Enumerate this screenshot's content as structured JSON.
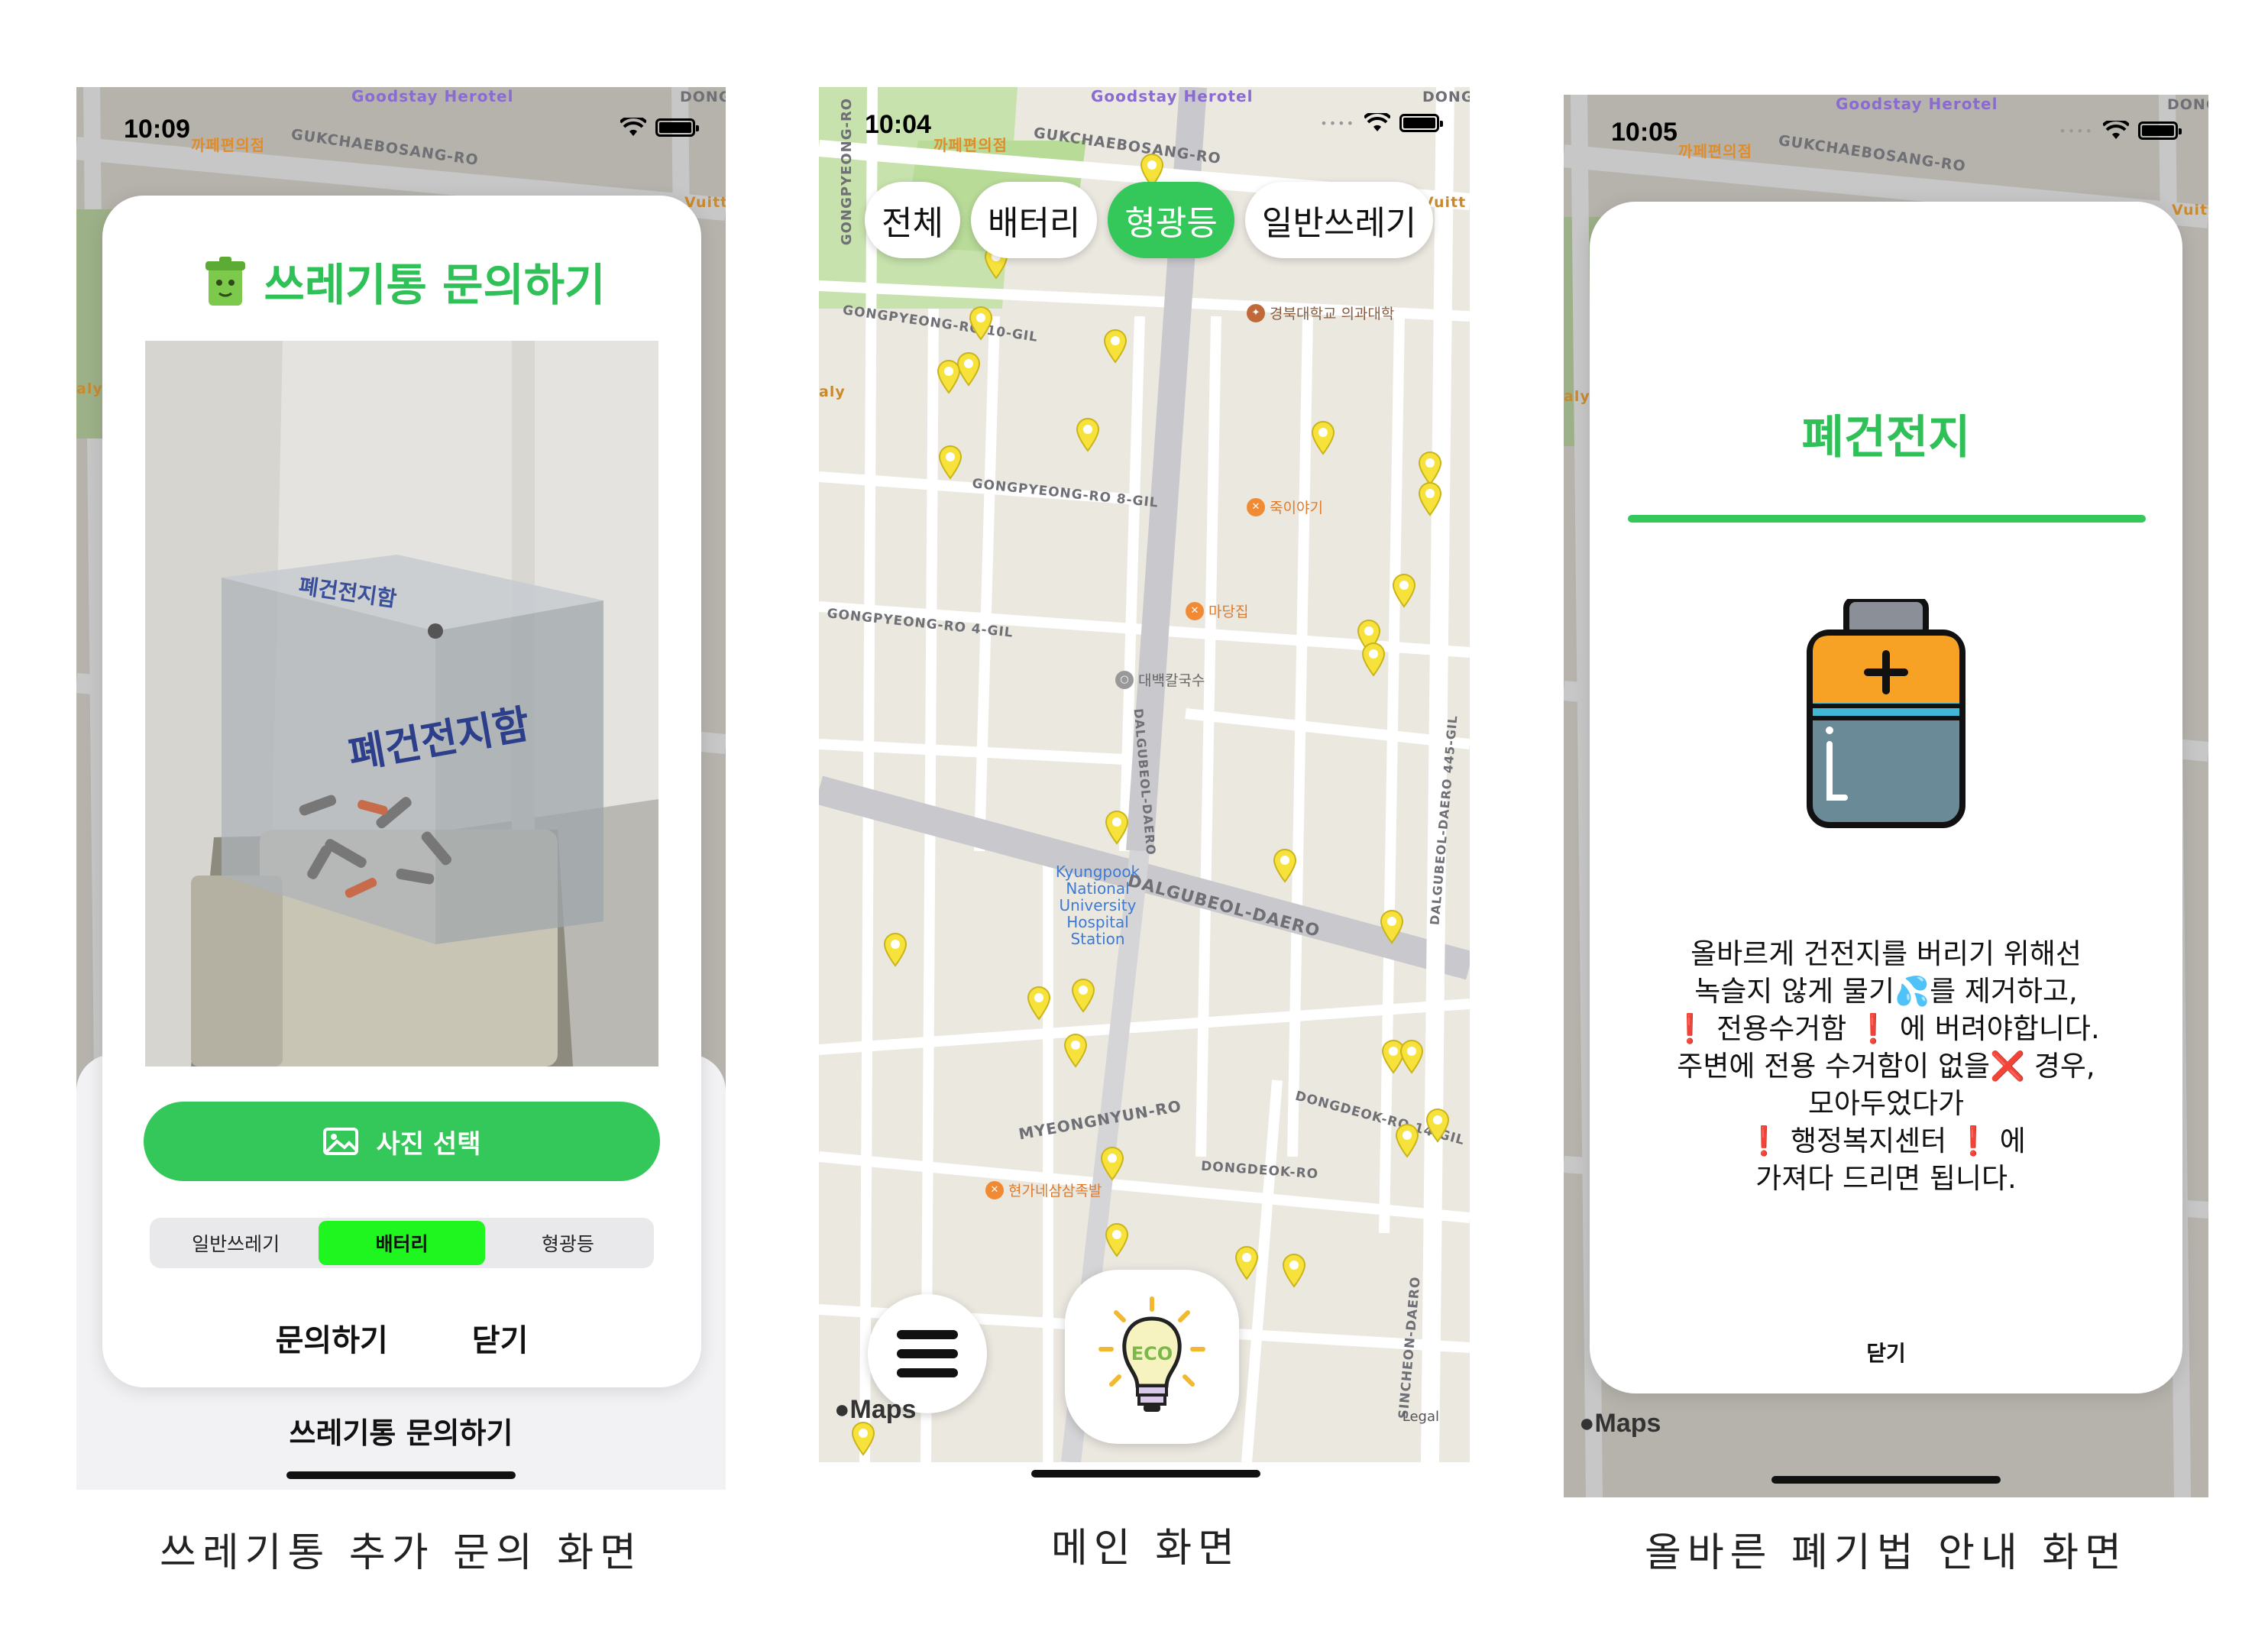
{
  "colors": {
    "accent": "#34c759",
    "selected_segment": "#1ff51f",
    "pin": "#f7e23c",
    "map_bg": "#ece8df"
  },
  "map": {
    "hotel": "Goodstay Herotel",
    "convenience": "까페편의점",
    "road_gukchae": "GUKCHAEBOSANG-RO",
    "road_gongpyeong_10": "GONGPYEONG-RO 10-GIL",
    "road_gongpyeong_8": "GONGPYEONG-RO 8-GIL",
    "road_gongpyeong_4": "GONGPYEONG-RO 4-GIL",
    "road_gongpyeong": "GONGPYEONG-RO",
    "road_dongdeok": "DONGDEOK-RO",
    "road_dongdeok_14": "DONGDEOK-RO 14-GIL",
    "road_dalgubeol": "DALGUBEOL-DAERO",
    "road_dalgubeol_445": "DALGUBEOL-DAERO 445-GIL",
    "road_myeongnyun": "MYEONGNYUN-RO",
    "road_sincheon": "SINCHEON-DAERO",
    "poi_medical": "경북대학교 의과대학",
    "poi_juk": "죽이야기",
    "poi_madang": "마당집",
    "poi_daebaek": "대백칼국수",
    "poi_hyeonga": "현가네삼삼족발",
    "station": "Kyungpook National University Hospital Station",
    "left_edge": "aly",
    "right_edge": "Vuitt",
    "top_right": "DONG",
    "apple_maps": "Maps",
    "legal": "Legal"
  },
  "screen1": {
    "time": "10:09",
    "title": "쓰레기통 문의하기",
    "photo_label_lid": "폐건전지함",
    "photo_label_front": "폐건전지함",
    "photo_button": "사진 선택",
    "segments": [
      "일반쓰레기",
      "배터리",
      "형광등"
    ],
    "selected_segment": "배터리",
    "submit": "문의하기",
    "close": "닫기",
    "sheet_title": "쓰레기통 문의하기",
    "caption": "쓰레기통 추가 문의 화면"
  },
  "screen2": {
    "time": "10:04",
    "filters": [
      "전체",
      "배터리",
      "형광등",
      "일반쓰레기"
    ],
    "selected_filter": "형광등",
    "eco_label": "ECO",
    "caption": "메인 화면"
  },
  "screen3": {
    "time": "10:05",
    "title": "폐건전지",
    "lines": [
      "올바르게 건전지를 버리기 위해선",
      "녹슬지 않게 물기💦를 제거하고,",
      "❗ 전용수거함 ❗ 에 버려야합니다.",
      "주변에 전용 수거함이 없을❌ 경우,",
      "모아두었다가",
      "❗ 행정복지센터 ❗ 에",
      "가져다 드리면 됩니다."
    ],
    "close": "닫기",
    "caption": "올바른 폐기법 안내 화면"
  }
}
